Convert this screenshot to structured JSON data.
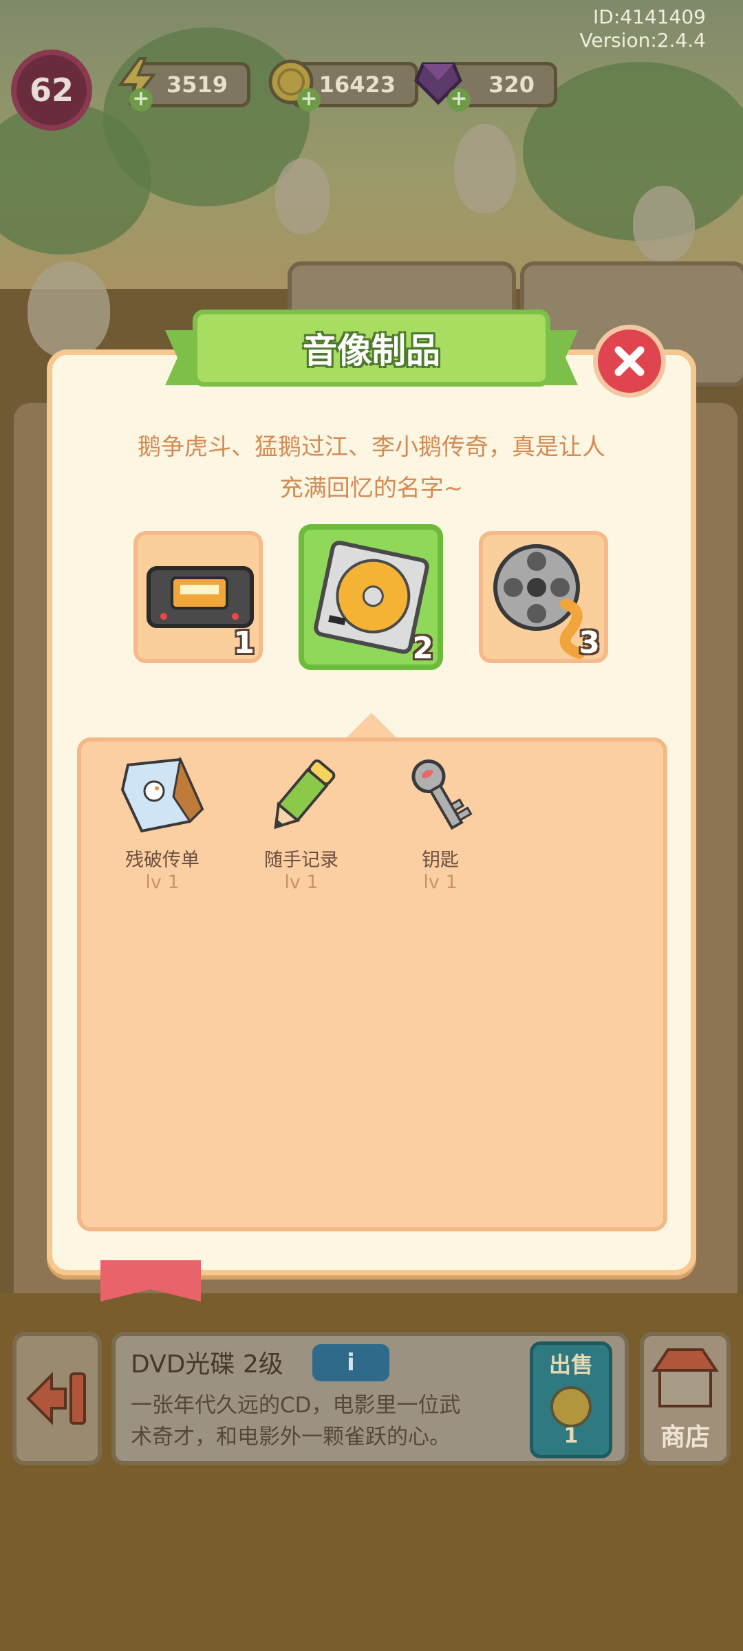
{
  "hud": {
    "player_id": "ID:4141409",
    "version": "Version:2.4.4",
    "level": "62",
    "energy": "3519",
    "coins": "16423",
    "gems": "320"
  },
  "modal": {
    "title": "音像制品",
    "description_line1": "鹅争虎斗、猛鹅过江、李小鹅传奇，真是让人",
    "description_line2": "充满回忆的名字~",
    "tiers": [
      {
        "num": "1",
        "icon": "vhs-tape-icon"
      },
      {
        "num": "2",
        "icon": "cd-case-icon",
        "selected": true
      },
      {
        "num": "3",
        "icon": "film-reel-icon"
      }
    ],
    "drops": [
      {
        "name": "残破传单",
        "level": "lv 1",
        "icon": "torn-flyer-icon"
      },
      {
        "name": "随手记录",
        "level": "lv 1",
        "icon": "pencil-icon"
      },
      {
        "name": "钥匙",
        "level": "lv 1",
        "icon": "key-icon"
      }
    ]
  },
  "bottom": {
    "item_title": "DVD光碟 2级",
    "info_label": "i",
    "item_desc_line1": "一张年代久远的CD，电影里一位武",
    "item_desc_line2": "术奇才，和电影外一颗雀跃的心。",
    "sell_label": "出售",
    "sell_price": "1",
    "shop_label": "商店"
  },
  "colors": {
    "title_green": "#a9dd62",
    "close_red": "#e0454f",
    "panel_peach": "#fccfa2",
    "desc_orange": "#d58a53"
  }
}
